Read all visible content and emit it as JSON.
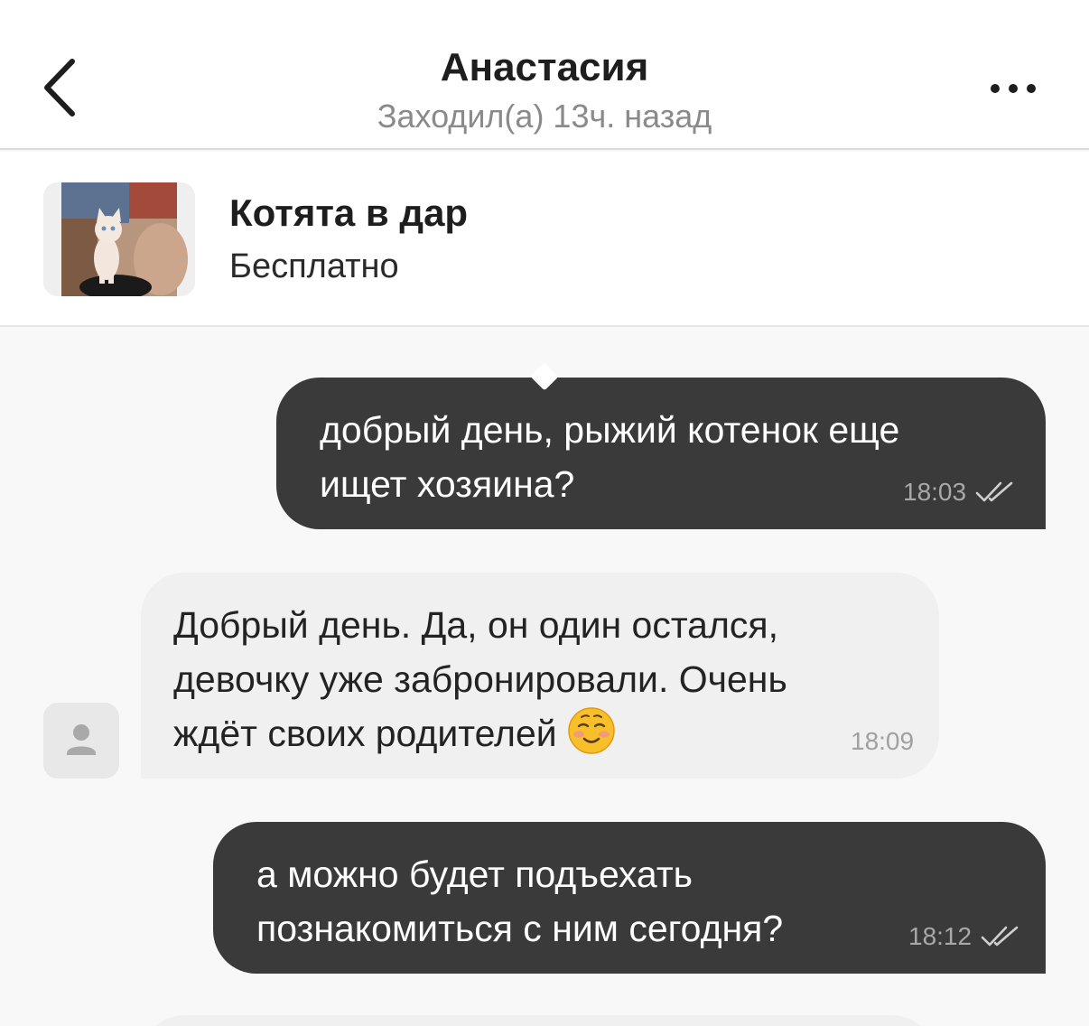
{
  "header": {
    "title": "Анастасия",
    "status": "Заходил(а) 13ч. назад"
  },
  "listing": {
    "title": "Котята в дар",
    "price": "Бесплатно"
  },
  "messages": [
    {
      "direction": "out",
      "text": "добрый день, рыжий котенок еще\nищет хозяина?",
      "time": "18:03",
      "read": true
    },
    {
      "direction": "in",
      "text_line1": "Добрый день. Да, он один остался,",
      "text_line2": "девочку уже забронировали. Очень",
      "text_line3": "ждёт своих родителей",
      "emoji": "smiling-face-emoji",
      "time": "18:09"
    },
    {
      "direction": "out",
      "text": "а можно будет подъехать\nпознакомиться с ним сегодня?",
      "time": "18:12",
      "read": true
    }
  ],
  "colors": {
    "outgoing_bubble": "#3a3a3a",
    "incoming_bubble": "#f0f0f0",
    "background": "#f8f8f8"
  },
  "icons": [
    "chevron-left-icon",
    "more-dots-icon",
    "double-check-icon",
    "person-icon"
  ]
}
